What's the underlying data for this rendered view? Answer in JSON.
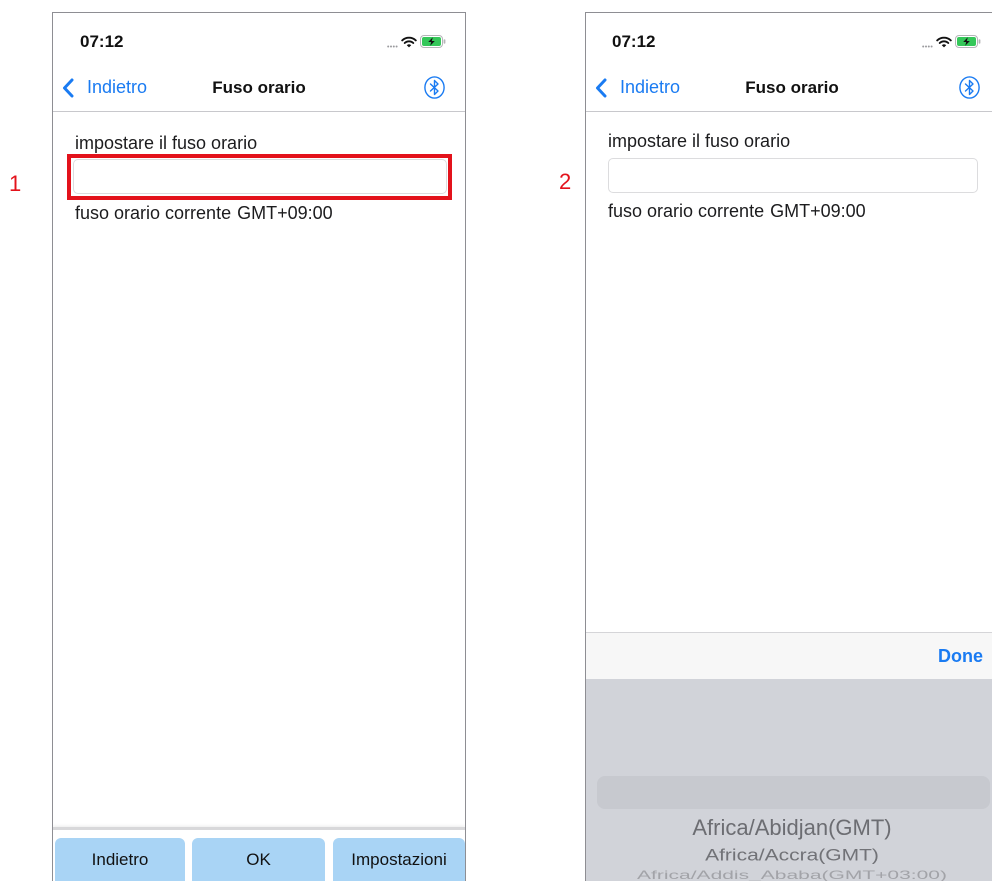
{
  "figure_labels": {
    "left": "1",
    "right": "2"
  },
  "colors": {
    "accent": "#1a7bf2",
    "highlight": "#e3121b",
    "button_bg": "#a9d4f5",
    "battery": "#34c759",
    "picker_bg": "#d1d3d9"
  },
  "screens": [
    {
      "status_bar": {
        "time": "07:12",
        "icons": [
          "cellular-dots-icon",
          "wifi-icon",
          "battery-charging-icon"
        ]
      },
      "nav_bar": {
        "back_icon": "chevron-left-icon",
        "back_label": "Indietro",
        "title": "Fuso orario",
        "right_icon": "bluetooth-icon"
      },
      "form": {
        "timezone_label": "impostare il fuso orario",
        "timezone_input_value": "",
        "current_label": "fuso orario corrente",
        "current_value": "GMT+09:00"
      },
      "bottom_buttons": [
        {
          "label": "Indietro"
        },
        {
          "label": "OK"
        },
        {
          "label": "Impostazioni"
        }
      ]
    },
    {
      "status_bar": {
        "time": "07:12",
        "icons": [
          "cellular-dots-icon",
          "wifi-icon",
          "battery-charging-icon"
        ]
      },
      "nav_bar": {
        "back_icon": "chevron-left-icon",
        "back_label": "Indietro",
        "title": "Fuso orario",
        "right_icon": "bluetooth-icon"
      },
      "form": {
        "timezone_label": "impostare il fuso orario",
        "timezone_input_value": "",
        "current_label": "fuso orario corrente",
        "current_value": "GMT+09:00"
      },
      "picker_toolbar": {
        "done_label": "Done"
      },
      "picker": {
        "items": [
          "Africa/Abidjan(GMT)",
          "Africa/Accra(GMT)",
          "Africa/Addis_Ababa(GMT+03:00)"
        ]
      }
    }
  ]
}
